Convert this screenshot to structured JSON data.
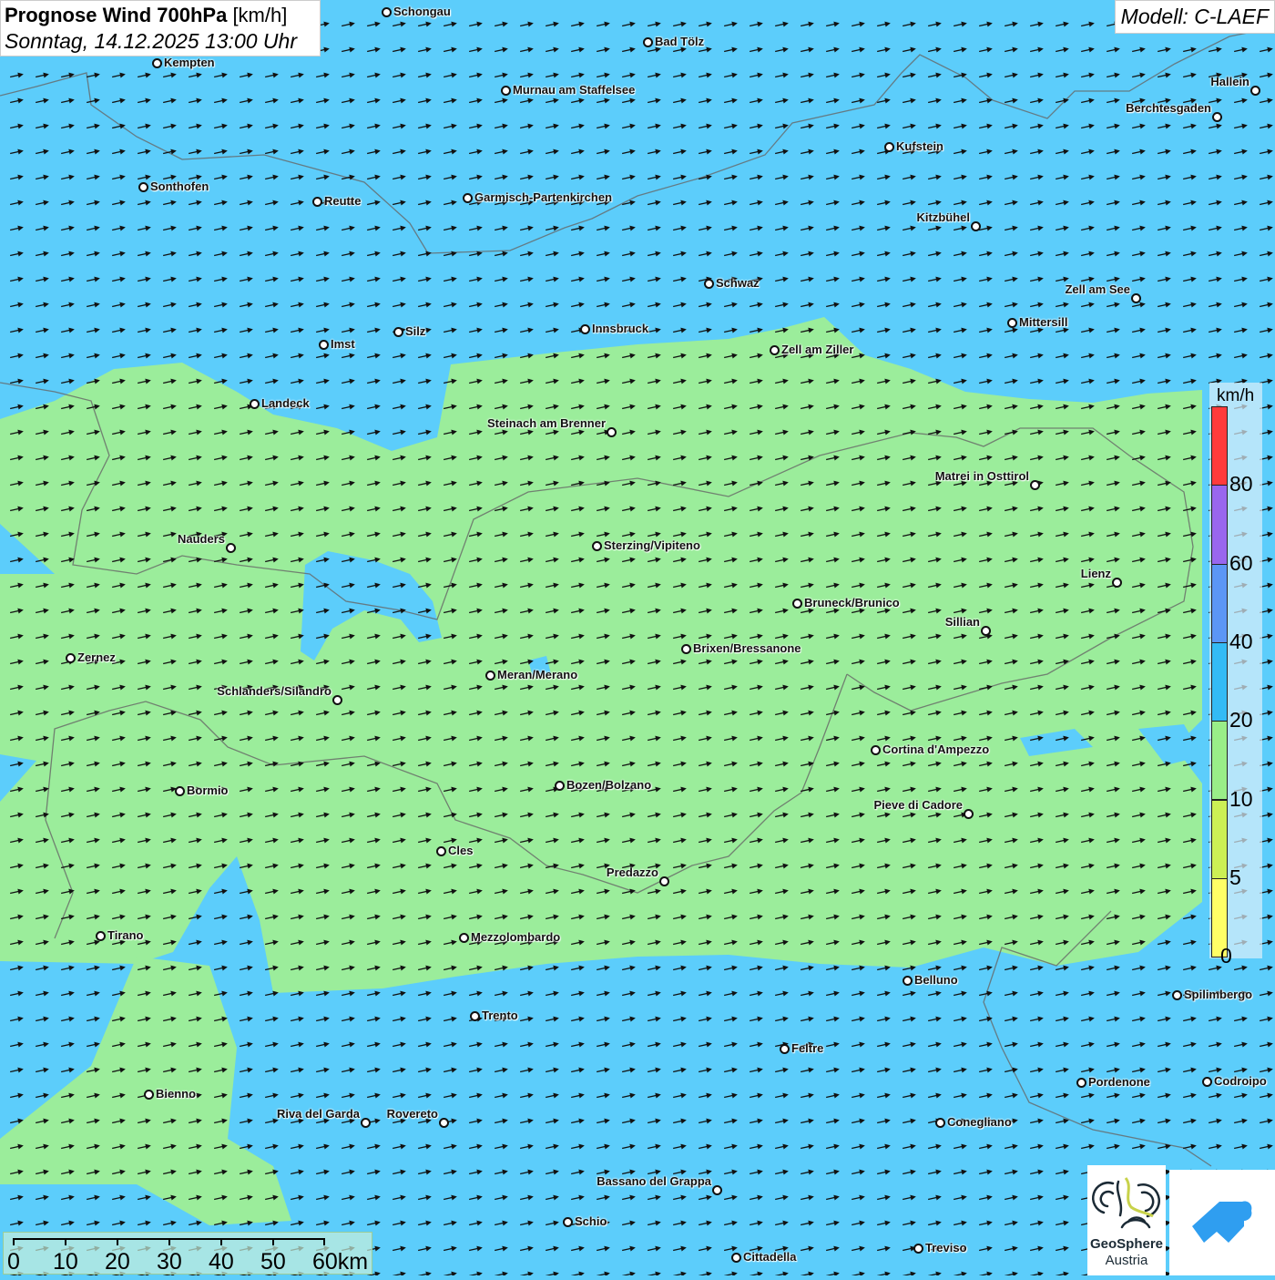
{
  "header": {
    "title_bold": "Prognose Wind 700hPa",
    "title_unit": "[km/h]",
    "subtitle": "Sonntag, 14.12.2025 13:00 Uhr"
  },
  "model": "Modell: C-LAEF",
  "legend": {
    "unit": "km/h",
    "classes": [
      {
        "from": 80,
        "color": "#ff3b3b"
      },
      {
        "from": 60,
        "label": "80",
        "color": "#9966ee"
      },
      {
        "from": 40,
        "label": "60",
        "color": "#5b96f5"
      },
      {
        "from": 20,
        "label": "40",
        "color": "#33bbf5"
      },
      {
        "from": 10,
        "label": "20",
        "color": "#99ee88"
      },
      {
        "from": 5,
        "label": "10",
        "color": "#ccf055"
      },
      {
        "from": 0,
        "label": "5",
        "color": "#ffff66"
      }
    ],
    "bottom_label": "0"
  },
  "colors": {
    "background_wind": "#5ccdfb",
    "low_wind": "#9bed9b"
  },
  "wind_arrows": {
    "direction": "west-southwest flow (arrows pointing east-northeast)",
    "color": "#111111"
  },
  "scale": {
    "labels": [
      "0",
      "10",
      "20",
      "30",
      "40",
      "50",
      "60km"
    ]
  },
  "logos": {
    "geosphere_line1": "GeoSphere",
    "geosphere_line2": "Austria"
  },
  "cities": [
    {
      "name": "Schongau",
      "side": "r"
    },
    {
      "name": "Bad Tölz",
      "side": "r"
    },
    {
      "name": "Kempten",
      "side": "r"
    },
    {
      "name": "Murnau am Staffelsee",
      "side": "r"
    },
    {
      "name": "Hallein",
      "side": "l"
    },
    {
      "name": "Berchtesgaden",
      "side": "l"
    },
    {
      "name": "Kufstein",
      "side": "r"
    },
    {
      "name": "Sonthofen",
      "side": "r"
    },
    {
      "name": "Reutte",
      "side": "r"
    },
    {
      "name": "Garmisch-Partenkirchen",
      "side": "r"
    },
    {
      "name": "Kitzbühel",
      "side": "l"
    },
    {
      "name": "Schwaz",
      "side": "r"
    },
    {
      "name": "Zell am See",
      "side": "l"
    },
    {
      "name": "Mittersill",
      "side": "r"
    },
    {
      "name": "Innsbruck",
      "side": "r"
    },
    {
      "name": "Silz",
      "side": "r"
    },
    {
      "name": "Imst",
      "side": "r"
    },
    {
      "name": "Zell am Ziller",
      "side": "r"
    },
    {
      "name": "Landeck",
      "side": "r"
    },
    {
      "name": "Steinach am Brenner",
      "side": "l"
    },
    {
      "name": "Matrei in Osttirol",
      "side": "l"
    },
    {
      "name": "Nauders",
      "side": "l"
    },
    {
      "name": "Sterzing/Vipiteno",
      "side": "r"
    },
    {
      "name": "Lienz",
      "side": "l"
    },
    {
      "name": "Bruneck/Brunico",
      "side": "r"
    },
    {
      "name": "Sillian",
      "side": "l"
    },
    {
      "name": "Brixen/Bressanone",
      "side": "r"
    },
    {
      "name": "Zernez",
      "side": "r"
    },
    {
      "name": "Meran/Merano",
      "side": "r"
    },
    {
      "name": "Schlanders/Silandro",
      "side": "l"
    },
    {
      "name": "Cortina d'Ampezzo",
      "side": "r"
    },
    {
      "name": "Bozen/Bolzano",
      "side": "r"
    },
    {
      "name": "Bormio",
      "side": "r"
    },
    {
      "name": "Pieve di Cadore",
      "side": "l"
    },
    {
      "name": "Cles",
      "side": "r"
    },
    {
      "name": "Predazzo",
      "side": "l"
    },
    {
      "name": "Tirano",
      "side": "r"
    },
    {
      "name": "Mezzolombardo",
      "side": "r"
    },
    {
      "name": "Belluno",
      "side": "r"
    },
    {
      "name": "Spilimbergo",
      "side": "r"
    },
    {
      "name": "Trento",
      "side": "r"
    },
    {
      "name": "Feltre",
      "side": "r"
    },
    {
      "name": "Pordenone",
      "side": "r"
    },
    {
      "name": "Codroipo",
      "side": "r"
    },
    {
      "name": "Bienno",
      "side": "r"
    },
    {
      "name": "Riva del Garda",
      "side": "l"
    },
    {
      "name": "Rovereto",
      "side": "l"
    },
    {
      "name": "Conegliano",
      "side": "r"
    },
    {
      "name": "Bassano del Grappa",
      "side": "l"
    },
    {
      "name": "Schio",
      "side": "r"
    },
    {
      "name": "Treviso",
      "side": "r"
    },
    {
      "name": "Cittadella",
      "side": "r"
    }
  ]
}
